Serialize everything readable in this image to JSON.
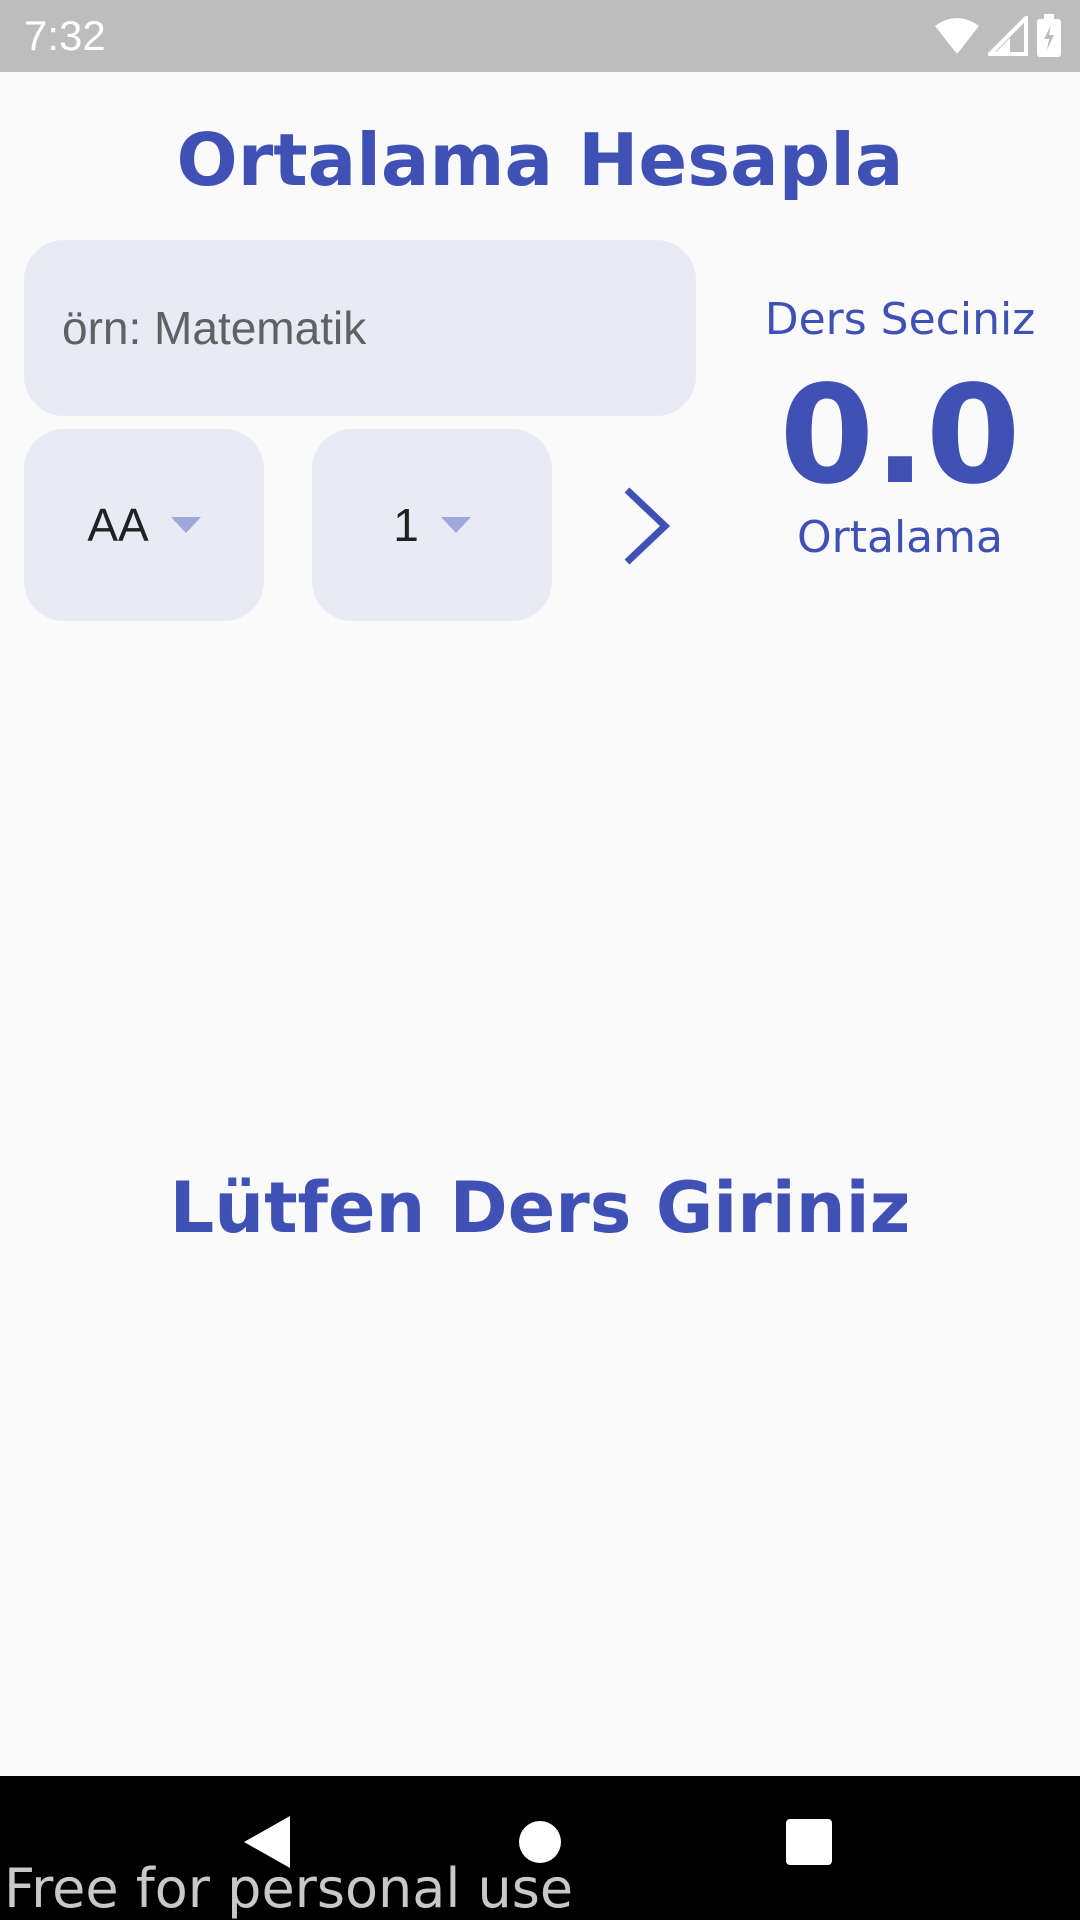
{
  "status_bar": {
    "time": "7:32",
    "icons": [
      "wifi-icon",
      "cell-signal-icon",
      "battery-charging-icon"
    ]
  },
  "header": {
    "title": "Ortalama Hesapla"
  },
  "form": {
    "course_name": {
      "value": "",
      "placeholder": "örn: Matematik"
    },
    "grade_dropdown": {
      "selected": "AA"
    },
    "credit_dropdown": {
      "selected": "1"
    },
    "add_button_icon": "chevron-right-icon"
  },
  "summary": {
    "label": "Ders Seciniz",
    "value": "0.0",
    "caption": "Ortalama"
  },
  "empty_state": {
    "message": "Lütfen Ders Giriniz"
  },
  "nav_bar": {
    "icons": [
      "back-icon",
      "home-icon",
      "recents-icon"
    ]
  },
  "watermark": "Free for personal use",
  "colors": {
    "accent": "#3f51b5",
    "field_background": "#e8eaf6",
    "page_background": "#fafafa",
    "status_bar": "#bdbdbd"
  }
}
